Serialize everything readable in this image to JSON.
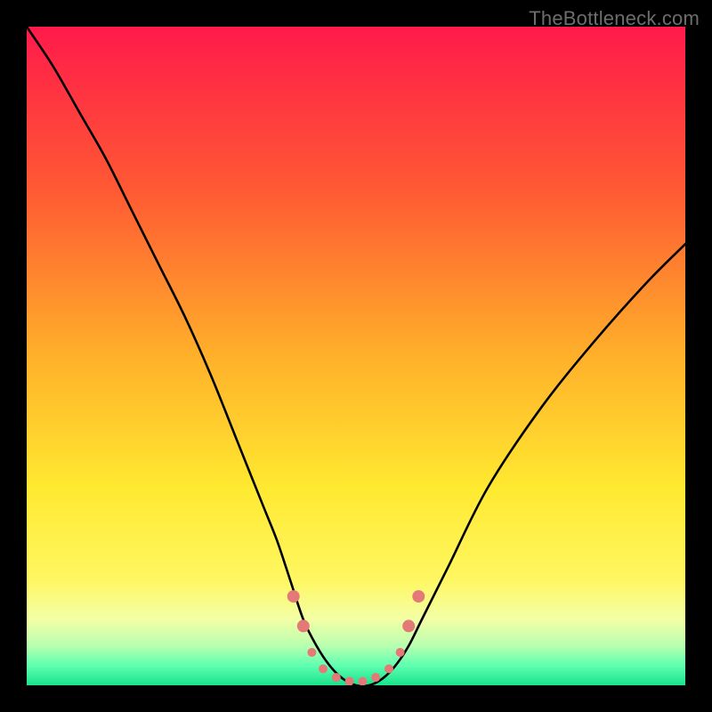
{
  "watermark": "TheBottleneck.com",
  "chart_data": {
    "type": "line",
    "title": "",
    "xlabel": "",
    "ylabel": "",
    "xlim": [
      0,
      100
    ],
    "ylim": [
      0,
      100
    ],
    "gradient_stops": [
      {
        "offset": 0,
        "color": "#ff1a4b"
      },
      {
        "offset": 25,
        "color": "#ff5a33"
      },
      {
        "offset": 50,
        "color": "#ffb02a"
      },
      {
        "offset": 70,
        "color": "#ffe930"
      },
      {
        "offset": 84,
        "color": "#fff762"
      },
      {
        "offset": 90,
        "color": "#f3ffa6"
      },
      {
        "offset": 94,
        "color": "#b9ffb0"
      },
      {
        "offset": 97,
        "color": "#5fffb0"
      },
      {
        "offset": 100,
        "color": "#18e38b"
      }
    ],
    "series": [
      {
        "name": "bottleneck-curve",
        "x": [
          0,
          4,
          8,
          12,
          16,
          20,
          24,
          28,
          32,
          36,
          38,
          40,
          42,
          44,
          46,
          48,
          50,
          52,
          54,
          56,
          58,
          60,
          64,
          70,
          78,
          86,
          94,
          100
        ],
        "y": [
          100,
          94,
          87,
          80,
          72,
          64,
          56,
          47,
          37,
          27,
          22,
          16,
          10,
          6,
          3,
          1,
          0,
          0,
          1,
          3,
          6,
          10,
          18,
          30,
          42,
          52,
          61,
          67
        ]
      }
    ],
    "markers": {
      "name": "optimum-zone",
      "color": "#e37a78",
      "radius_large": 7,
      "radius_small": 5,
      "points": [
        {
          "x": 40.5,
          "y": 13.5,
          "r": "large"
        },
        {
          "x": 42.0,
          "y": 9.0,
          "r": "large"
        },
        {
          "x": 43.3,
          "y": 5.0,
          "r": "small"
        },
        {
          "x": 45.0,
          "y": 2.5,
          "r": "small"
        },
        {
          "x": 47.0,
          "y": 1.2,
          "r": "small"
        },
        {
          "x": 49.0,
          "y": 0.6,
          "r": "small"
        },
        {
          "x": 51.0,
          "y": 0.6,
          "r": "small"
        },
        {
          "x": 53.0,
          "y": 1.2,
          "r": "small"
        },
        {
          "x": 55.0,
          "y": 2.5,
          "r": "small"
        },
        {
          "x": 56.7,
          "y": 5.0,
          "r": "small"
        },
        {
          "x": 58.0,
          "y": 9.0,
          "r": "large"
        },
        {
          "x": 59.5,
          "y": 13.5,
          "r": "large"
        }
      ]
    }
  }
}
